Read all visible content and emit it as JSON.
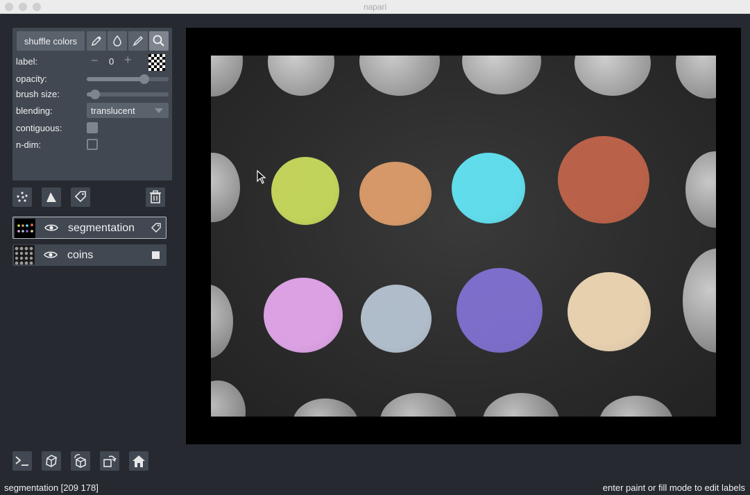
{
  "window": {
    "title": "napari"
  },
  "controls": {
    "shuffle_label": "shuffle colors",
    "label_text": "label:",
    "label_value": "0",
    "opacity_text": "opacity:",
    "opacity_value": 0.7,
    "brush_size_text": "brush size:",
    "brush_size_value": 0.1,
    "blending_text": "blending:",
    "blending_value": "translucent",
    "contiguous_text": "contiguous:",
    "contiguous_checked": true,
    "ndim_text": "n-dim:",
    "ndim_checked": false
  },
  "layers": [
    {
      "name": "segmentation",
      "visible": true,
      "selected": true,
      "type_icon": "label-tag-icon"
    },
    {
      "name": "coins",
      "visible": true,
      "selected": false,
      "type_icon": "image-square-icon"
    }
  ],
  "status": {
    "left": "segmentation [209 178]",
    "right": "enter paint or fill mode to edit labels"
  },
  "colors": {
    "background": "#262930",
    "panel": "#414851",
    "button": "#5a626c",
    "labels": [
      "#cddf5e",
      "#e2a06c",
      "#64e8f8",
      "#c4654b",
      "#e8aaf0",
      "#b9c7d6",
      "#8372d6",
      "#f4dcb8"
    ]
  }
}
